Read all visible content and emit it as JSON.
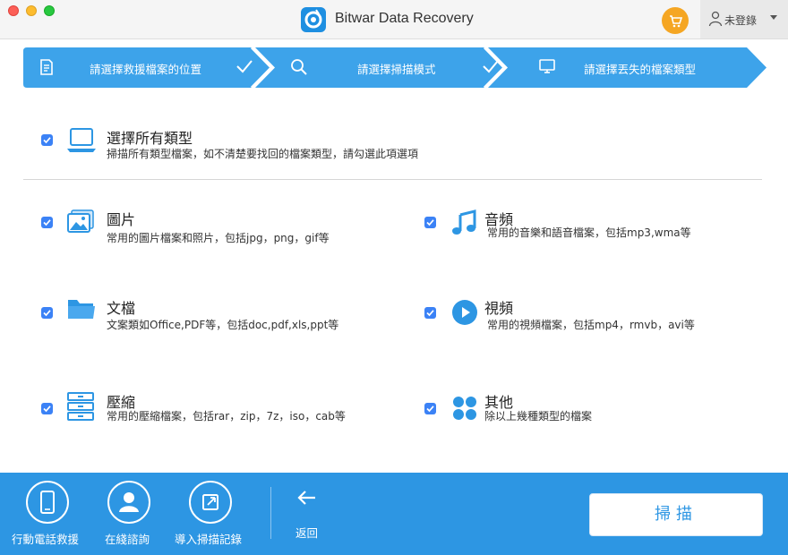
{
  "app": {
    "title": "Bitwar Data Recovery"
  },
  "header": {
    "user_label": "未登錄"
  },
  "steps": [
    {
      "label": "請選擇救援檔案的位置",
      "icon": "document-icon",
      "done": true
    },
    {
      "label": "請選擇掃描模式",
      "icon": "search-icon",
      "done": true
    },
    {
      "label": "請選擇丟失的檔案類型",
      "icon": "monitor-icon",
      "done": false
    }
  ],
  "select_all": {
    "title": "選擇所有類型",
    "desc": "掃描所有類型檔案，如不清楚要找回的檔案類型，請勾選此項選項",
    "checked": true
  },
  "categories": {
    "pictures": {
      "title": "圖片",
      "desc": "常用的圖片檔案和照片，包括jpg，png，gif等",
      "checked": true
    },
    "audio": {
      "title": "音頻",
      "desc": "常用的音樂和語音檔案，包括mp3,wma等",
      "checked": true
    },
    "documents": {
      "title": "文檔",
      "desc": "文案類如Office,PDF等，包括doc,pdf,xls,ppt等",
      "checked": true
    },
    "video": {
      "title": "視頻",
      "desc": "常用的視頻檔案，包括mp4，rmvb，avi等",
      "checked": true
    },
    "archives": {
      "title": "壓縮",
      "desc": "常用的壓縮檔案，包括rar，zip，7z，iso，cab等",
      "checked": true
    },
    "others": {
      "title": "其他",
      "desc": "除以上幾種類型的檔案",
      "checked": true
    }
  },
  "bottom": {
    "tools": [
      {
        "label": "行動電話救援",
        "icon": "phone-icon"
      },
      {
        "label": "在綫諮詢",
        "icon": "user-icon"
      },
      {
        "label": "導入掃描記錄",
        "icon": "import-icon"
      }
    ],
    "back_label": "返回",
    "scan_label": "掃描"
  },
  "colors": {
    "accent": "#2d96e3",
    "step_bar": "#3da3ea",
    "checkbox": "#3b82f6",
    "cart": "#f5a623"
  }
}
